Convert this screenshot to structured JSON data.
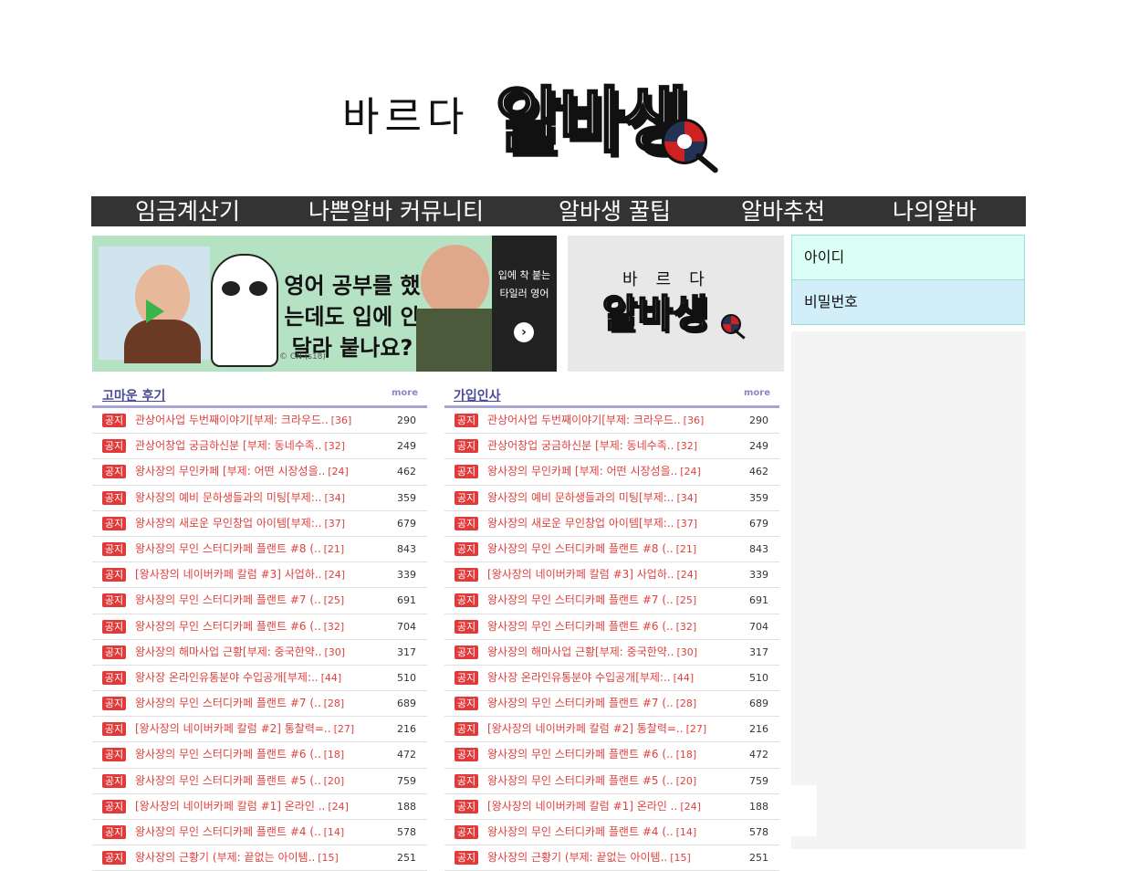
{
  "logo": {
    "small": "바르다",
    "big": "알바생"
  },
  "nav": [
    "임금계산기",
    "나쁜알바 커뮤니티",
    "알바생 꿀팁",
    "알바추천",
    "나의알바"
  ],
  "banner_ad": {
    "headline": "영어 공부를 했는데도 입에 안 달라 붙나요?",
    "side_text": "입에 착 붙는 타일러 영어",
    "credit": "© CN (s18)",
    "arrow": "›"
  },
  "banner_logo": {
    "small": "바르다",
    "big": "알바생"
  },
  "login": {
    "id_placeholder": "아이디",
    "pw_placeholder": "비밀번호"
  },
  "boards": [
    {
      "title": "고마운 후기",
      "more": "more"
    },
    {
      "title": "가입인사",
      "more": "more"
    }
  ],
  "badge": "공지",
  "posts": [
    {
      "title": "관상어사업 두번째이야기[부제: 크라우드..",
      "comments": "[36]",
      "views": "290"
    },
    {
      "title": "관상어창업 궁금하신분 [부제: 동네수족..",
      "comments": "[32]",
      "views": "249"
    },
    {
      "title": "왕사장의 무인카페 [부제: 어떤 시장성을..",
      "comments": "[24]",
      "views": "462"
    },
    {
      "title": "왕사장의 예비 문하생들과의 미팅[부제:..",
      "comments": "[34]",
      "views": "359"
    },
    {
      "title": "왕사장의 새로운 무인창업 아이템[부제:..",
      "comments": "[37]",
      "views": "679"
    },
    {
      "title": "왕사장의 무인 스터디카페 플랜트 #8 (..",
      "comments": "[21]",
      "views": "843"
    },
    {
      "title": "[왕사장의 네이버카페 칼럼 #3] 사업하..",
      "comments": "[24]",
      "views": "339"
    },
    {
      "title": "왕사장의 무인 스터디카페 플랜트 #7 (..",
      "comments": "[25]",
      "views": "691"
    },
    {
      "title": "왕사장의 무인 스터디카페 플랜트 #6 (..",
      "comments": "[32]",
      "views": "704"
    },
    {
      "title": "왕사장의 해마사업 근황[부제: 중국한약..",
      "comments": "[30]",
      "views": "317"
    },
    {
      "title": "왕사장 온라인유통분야 수입공개[부제:..",
      "comments": "[44]",
      "views": "510"
    },
    {
      "title": "왕사장의 무인 스터디카페 플랜트 #7 (..",
      "comments": "[28]",
      "views": "689"
    },
    {
      "title": "[왕사장의 네이버카페 칼럼 #2] 통찰력=..",
      "comments": "[27]",
      "views": "216"
    },
    {
      "title": "왕사장의 무인 스터디카페 플랜트 #6 (..",
      "comments": "[18]",
      "views": "472"
    },
    {
      "title": "왕사장의 무인 스터디카페 플랜트 #5 (..",
      "comments": "[20]",
      "views": "759"
    },
    {
      "title": "[왕사장의 네이버카페 칼럼 #1] 온라인 ..",
      "comments": "[24]",
      "views": "188"
    },
    {
      "title": "왕사장의 무인 스터디카페 플랜트 #4 (..",
      "comments": "[14]",
      "views": "578"
    },
    {
      "title": "왕사장의 근황기 (부제: 끝없는 아이템..",
      "comments": "[15]",
      "views": "251"
    }
  ]
}
